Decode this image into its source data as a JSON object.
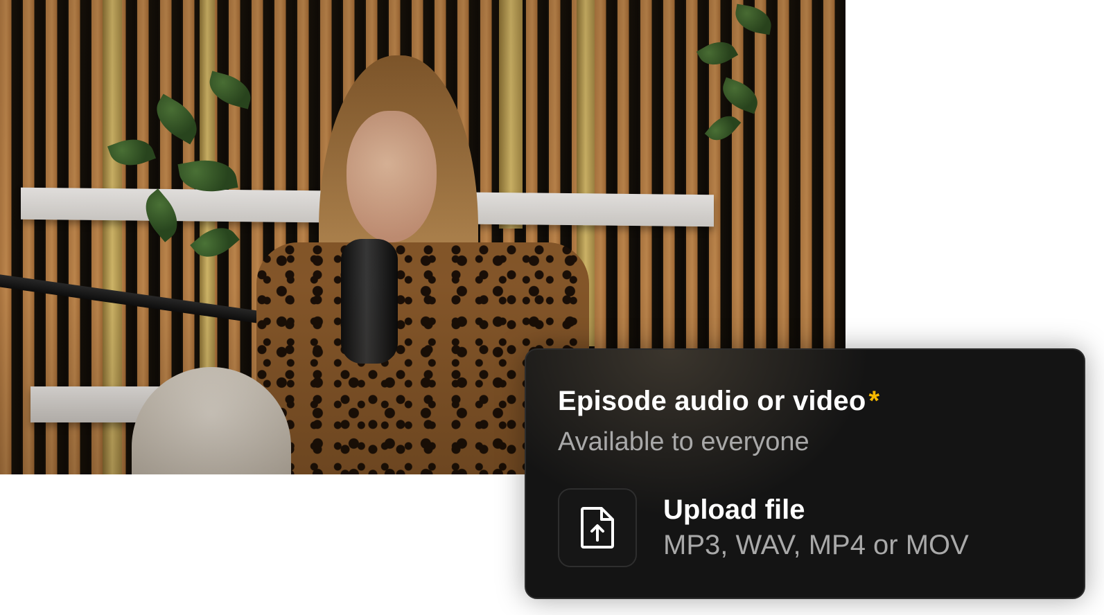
{
  "video": {
    "description_icon": "podcast-video-still"
  },
  "upload_card": {
    "title": "Episode audio or video",
    "required_marker": "*",
    "subtitle": "Available to everyone",
    "upload": {
      "icon": "file-upload-icon",
      "label": "Upload file",
      "formats": "MP3, WAV, MP4 or MOV"
    },
    "colors": {
      "card_background": "#141414",
      "required_accent": "#f5b800",
      "primary_text": "#ffffff",
      "secondary_text": "#a9a9a9"
    }
  }
}
